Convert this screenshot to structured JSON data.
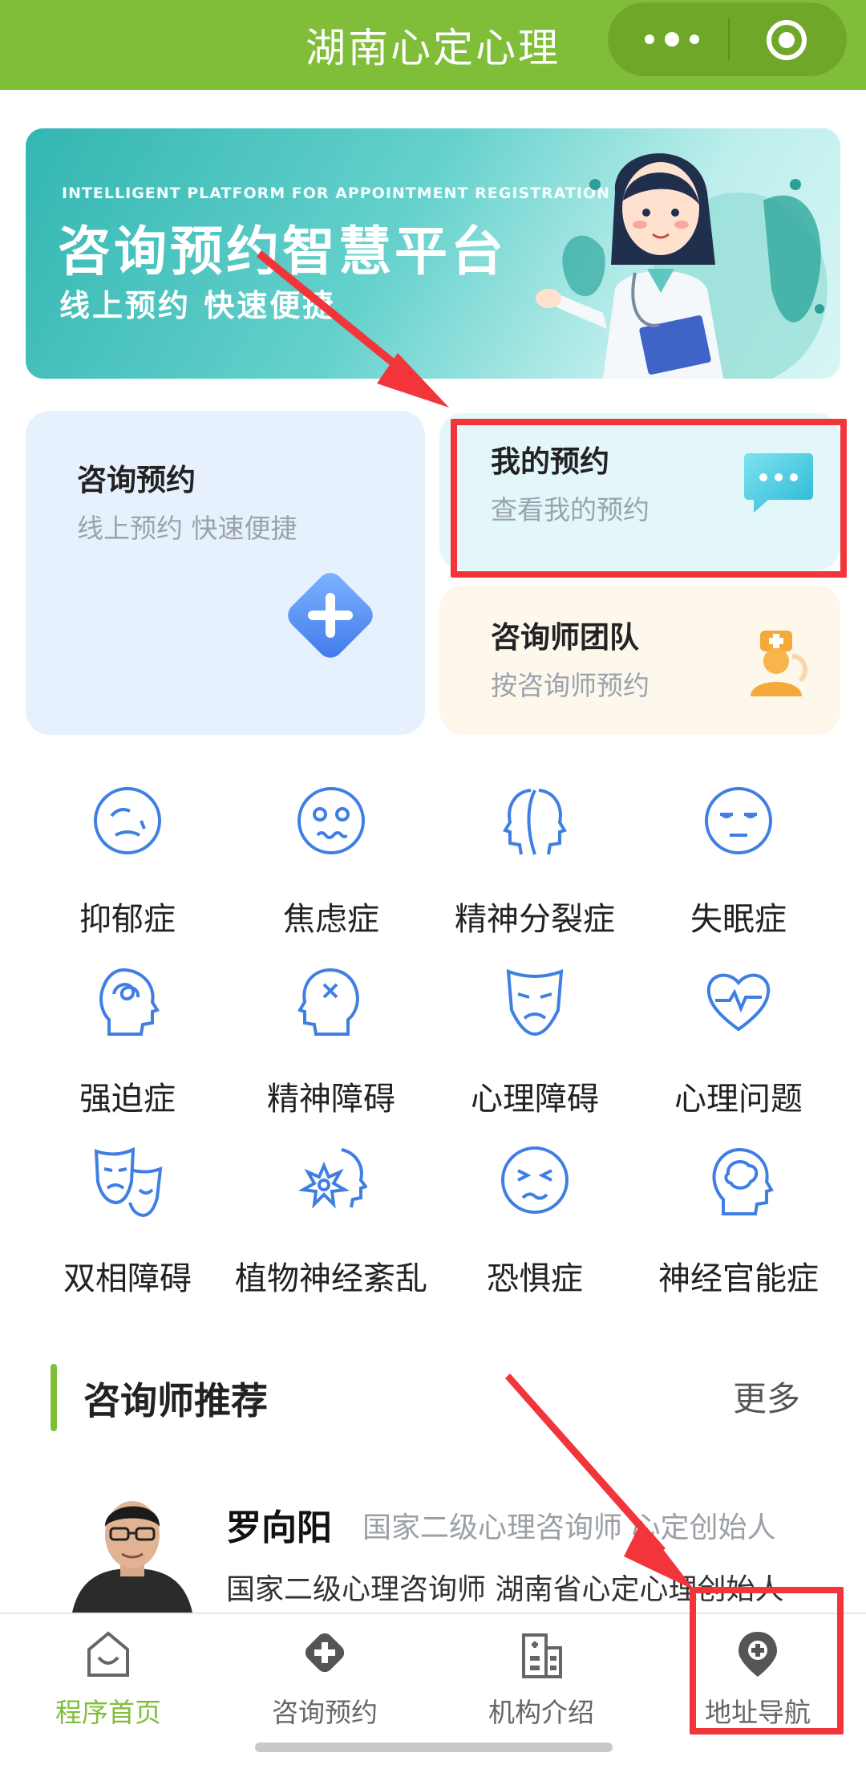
{
  "app": {
    "title": "湖南心定心理"
  },
  "banner": {
    "english": "INTELLIGENT PLATFORM FOR APPOINTMENT REGISTRATION",
    "title": "咨询预约智慧平台",
    "subtitle": "线上预约 快速便捷"
  },
  "cards": {
    "consult": {
      "title": "咨询预约",
      "subtitle": "线上预约 快速便捷",
      "icon": "plus-diamond-icon"
    },
    "my_booking": {
      "title": "我的预约",
      "subtitle": "查看我的预约",
      "icon": "chat-bubble-icon"
    },
    "team": {
      "title": "咨询师团队",
      "subtitle": "按咨询师预约",
      "icon": "doctor-icon"
    }
  },
  "categories": [
    {
      "label": "抑郁症",
      "icon": "sad-face-icon"
    },
    {
      "label": "焦虑症",
      "icon": "dizzy-face-icon"
    },
    {
      "label": "精神分裂症",
      "icon": "split-head-icon"
    },
    {
      "label": "失眠症",
      "icon": "sleepy-face-icon"
    },
    {
      "label": "强迫症",
      "icon": "tangled-head-icon"
    },
    {
      "label": "精神障碍",
      "icon": "x-head-icon"
    },
    {
      "label": "心理障碍",
      "icon": "mask-icon"
    },
    {
      "label": "心理问题",
      "icon": "heartbeat-icon"
    },
    {
      "label": "双相障碍",
      "icon": "theater-masks-icon"
    },
    {
      "label": "植物神经紊乱",
      "icon": "burst-head-icon"
    },
    {
      "label": "恐惧症",
      "icon": "fear-face-icon"
    },
    {
      "label": "神经官能症",
      "icon": "brain-head-icon"
    }
  ],
  "recommend": {
    "title": "咨询师推荐",
    "more": "更多",
    "counselor": {
      "name": "罗向阳",
      "title": "国家二级心理咨询师 心定创始人",
      "desc": "国家二级心理咨询师 湖南省心定心理创始人"
    }
  },
  "tabs": [
    {
      "label": "程序首页",
      "icon": "home-icon",
      "active": true
    },
    {
      "label": "咨询预约",
      "icon": "plus-badge-icon",
      "active": false
    },
    {
      "label": "机构介绍",
      "icon": "hospital-icon",
      "active": false
    },
    {
      "label": "地址导航",
      "icon": "location-pin-icon",
      "active": false
    }
  ],
  "colors": {
    "brand": "#80be3a",
    "icon_blue": "#3f7fe3",
    "highlight_red": "#f1353b"
  }
}
